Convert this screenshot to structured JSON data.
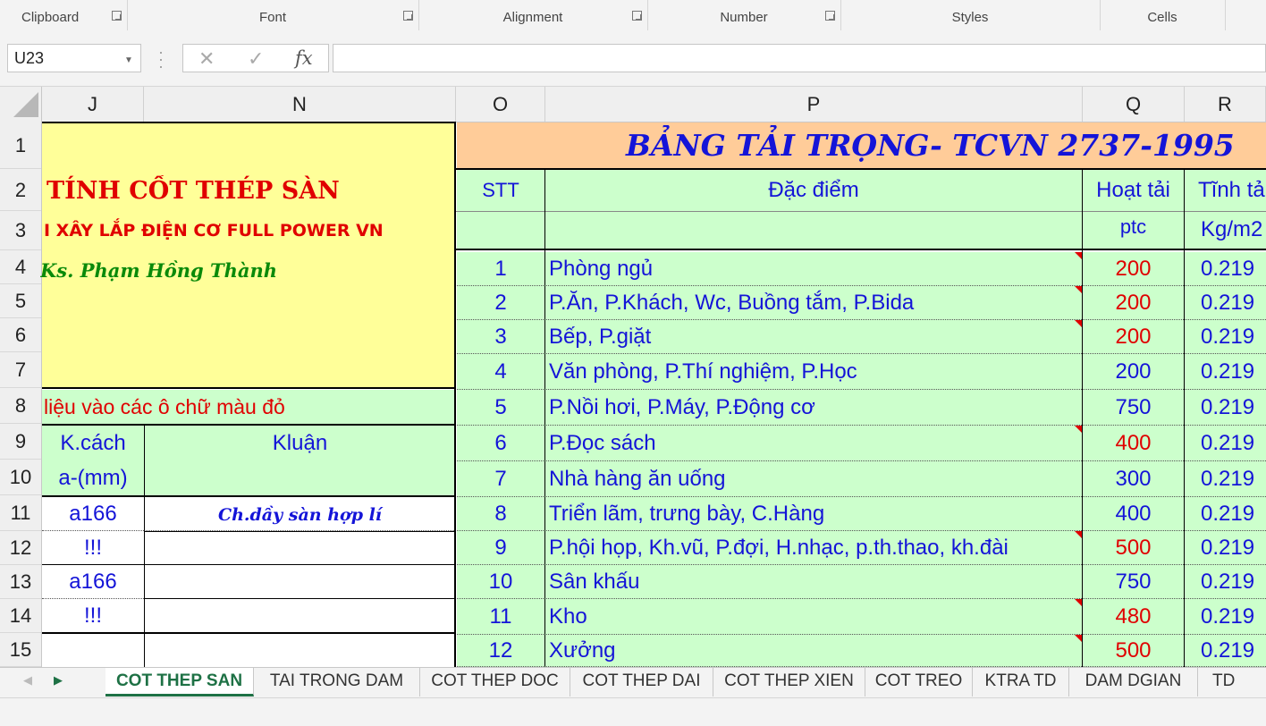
{
  "ribbon": {
    "groups": [
      "Clipboard",
      "Font",
      "Alignment",
      "Number",
      "Styles",
      "Cells"
    ]
  },
  "formula_bar": {
    "name_box": "U23",
    "cancel_glyph": "✕",
    "enter_glyph": "✓",
    "fx_glyph": "fx",
    "formula": ""
  },
  "columns": [
    "J",
    "N",
    "O",
    "P",
    "Q",
    "R"
  ],
  "rows": [
    "1",
    "2",
    "3",
    "4",
    "5",
    "6",
    "7",
    "8",
    "9",
    "10",
    "11",
    "12",
    "13",
    "14",
    "15"
  ],
  "left_panel": {
    "title": "TÍNH CỐT THÉP SÀN",
    "company": "I XÂY LẮP ĐIỆN CƠ FULL POWER VN",
    "author": "Ks. Phạm Hồng Thành",
    "instruction": "liệu vào các ô chữ màu đỏ",
    "hdr_spacing_1": "K.cách",
    "hdr_spacing_2": "a-(mm)",
    "hdr_conclusion": "Kluận",
    "row11_spacing": "a166",
    "row11_conclusion": "Ch.dầy sàn hợp lí",
    "row12_spacing": "!!!",
    "row13_spacing": "a166",
    "row14_spacing": "!!!"
  },
  "load_table": {
    "title": "BẢNG TẢI TRỌNG- TCVN 2737-1995",
    "hdr_stt": "STT",
    "hdr_feature": "Đặc điểm",
    "hdr_live_load": "Hoạt tải",
    "hdr_live_unit": "ptc",
    "hdr_dead_load": "Tĩnh tả",
    "hdr_dead_unit": "Kg/m2",
    "rows": [
      {
        "stt": "1",
        "feature": "Phòng ngủ",
        "live": "200",
        "dead": "0.219",
        "live_red": true,
        "note": true
      },
      {
        "stt": "2",
        "feature": "P.Ăn, P.Khách, Wc, Buồng tắm, P.Bida",
        "live": "200",
        "dead": "0.219",
        "live_red": true,
        "note": true
      },
      {
        "stt": "3",
        "feature": "Bếp, P.giặt",
        "live": "200",
        "dead": "0.219",
        "live_red": true,
        "note": true
      },
      {
        "stt": "4",
        "feature": "Văn phòng, P.Thí nghiệm, P.Học",
        "live": "200",
        "dead": "0.219",
        "live_red": false,
        "note": false
      },
      {
        "stt": "5",
        "feature": "P.Nồi hơi, P.Máy, P.Động cơ",
        "live": "750",
        "dead": "0.219",
        "live_red": false,
        "note": false
      },
      {
        "stt": "6",
        "feature": "P.Đọc sách",
        "live": "400",
        "dead": "0.219",
        "live_red": true,
        "note": true
      },
      {
        "stt": "7",
        "feature": "Nhà hàng ăn uống",
        "live": "300",
        "dead": "0.219",
        "live_red": false,
        "note": false
      },
      {
        "stt": "8",
        "feature": "Triển lãm, trưng bày, C.Hàng",
        "live": "400",
        "dead": "0.219",
        "live_red": false,
        "note": false
      },
      {
        "stt": "9",
        "feature": "P.hội họp, Kh.vũ, P.đợi, H.nhạc, p.th.thao, kh.đài",
        "live": "500",
        "dead": "0.219",
        "live_red": true,
        "note": true
      },
      {
        "stt": "10",
        "feature": "Sân khấu",
        "live": "750",
        "dead": "0.219",
        "live_red": false,
        "note": false
      },
      {
        "stt": "11",
        "feature": "Kho",
        "live": "480",
        "dead": "0.219",
        "live_red": true,
        "note": true
      },
      {
        "stt": "12",
        "feature": "Xưởng",
        "live": "500",
        "dead": "0.219",
        "live_red": true,
        "note": true
      }
    ]
  },
  "tabs": [
    "COT THEP SAN",
    "TAI TRONG DAM",
    "COT THEP DOC",
    "COT THEP DAI",
    "COT THEP XIEN",
    "COT TREO",
    "KTRA TD",
    "DAM DGIAN",
    "TD COT"
  ],
  "active_tab": "COT THEP SAN",
  "colors": {
    "blue_text": "#1414d8",
    "red_text": "#e00000",
    "yellow_fill": "#ffff99",
    "green_fill": "#ccffcc",
    "orange_fill": "#ffcc99",
    "active_tab": "#1e7145"
  }
}
